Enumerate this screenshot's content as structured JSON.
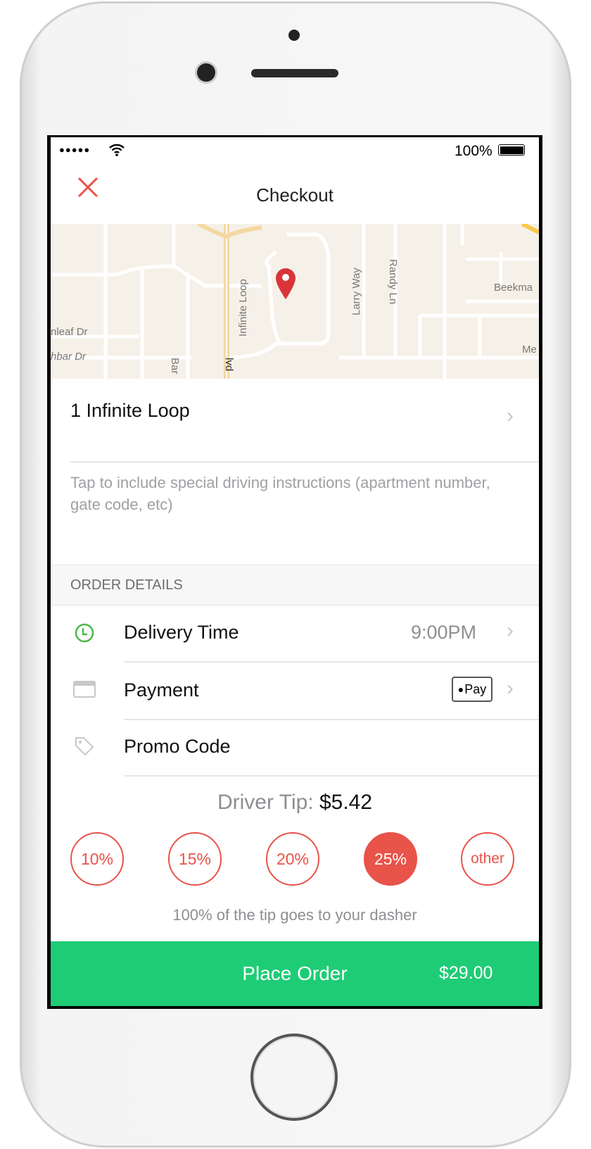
{
  "status_bar": {
    "battery": "100%",
    "signal_icon": "signal-dots-icon",
    "wifi_icon": "wifi-icon",
    "battery_icon": "battery-icon"
  },
  "nav": {
    "title": "Checkout",
    "close_icon": "close-icon"
  },
  "map": {
    "labels": [
      "Infinite Loop",
      "Larry Way",
      "Randy Ln",
      "Beekma",
      "nleaf Dr",
      "hbar Dr",
      "Bar",
      "lvd",
      "Me"
    ],
    "pin_icon": "map-pin-icon"
  },
  "address": {
    "line": "1 Infinite Loop",
    "instructions_placeholder": "Tap to include special driving instructions (apartment number, gate code, etc)"
  },
  "order_details": {
    "header": "ORDER DETAILS",
    "rows": [
      {
        "label": "Delivery Time",
        "value": "9:00PM",
        "icon": "clock-icon"
      },
      {
        "label": "Payment",
        "value": "Pay",
        "icon": "credit-card-icon"
      },
      {
        "label": "Promo Code",
        "icon": "tag-icon"
      }
    ]
  },
  "tip": {
    "label": "Driver Tip:",
    "amount": "$5.42",
    "options": [
      "10%",
      "15%",
      "20%",
      "25%",
      "other"
    ],
    "selected": "25%",
    "note": "100% of the tip goes to your dasher"
  },
  "place_order": {
    "label": "Place Order",
    "total": "$29.00"
  },
  "colors": {
    "accent_red": "#e8534a",
    "green": "#1fcc76",
    "clock_green": "#4cb848"
  }
}
